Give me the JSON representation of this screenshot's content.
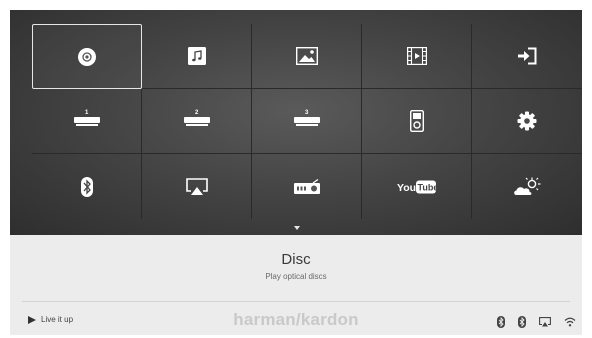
{
  "menu": {
    "items": [
      {
        "name": "Disc",
        "icon": "disc-icon",
        "selected": true
      },
      {
        "name": "Music",
        "icon": "music-icon"
      },
      {
        "name": "Photos",
        "icon": "photo-icon"
      },
      {
        "name": "Video",
        "icon": "film-icon"
      },
      {
        "name": "Input",
        "icon": "input-icon"
      },
      {
        "name": "HDMI 1",
        "icon": "hdmi-icon",
        "label": "1"
      },
      {
        "name": "HDMI 2",
        "icon": "hdmi-icon",
        "label": "2"
      },
      {
        "name": "HDMI 3",
        "icon": "hdmi-icon",
        "label": "3"
      },
      {
        "name": "iPod",
        "icon": "ipod-icon"
      },
      {
        "name": "Settings",
        "icon": "gear-icon"
      },
      {
        "name": "Bluetooth",
        "icon": "bluetooth-icon"
      },
      {
        "name": "AirPlay",
        "icon": "airplay-icon"
      },
      {
        "name": "Radio",
        "icon": "radio-icon"
      },
      {
        "name": "YouTube",
        "icon": "youtube-icon",
        "logo_text_1": "You",
        "logo_text_2": "Tube"
      },
      {
        "name": "Weather",
        "icon": "weather-icon"
      }
    ]
  },
  "info": {
    "title": "Disc",
    "subtitle": "Play optical discs"
  },
  "footer": {
    "tagline": "Live it up",
    "brand": "harman/kardon",
    "status_icons": [
      "bluetooth-icon",
      "bluetooth-icon",
      "airplay-icon",
      "wifi-icon"
    ]
  },
  "colors": {
    "menu_bg": "#454545",
    "info_bg": "#ececec",
    "brand": "#c9c9c9",
    "icon": "#ffffff"
  }
}
